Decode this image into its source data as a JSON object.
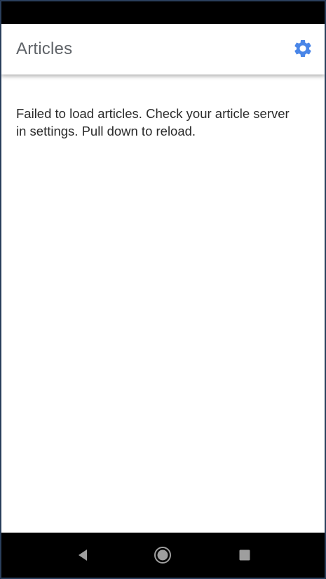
{
  "app_bar": {
    "title": "Articles",
    "settings_icon": "gear-icon",
    "accent_color": "#4a86e8"
  },
  "content": {
    "message": "Failed to load articles. Check your article server in settings. Pull down to reload."
  },
  "nav_bar": {
    "back_icon": "triangle-back-icon",
    "home_icon": "circle-home-icon",
    "recents_icon": "square-recents-icon"
  }
}
